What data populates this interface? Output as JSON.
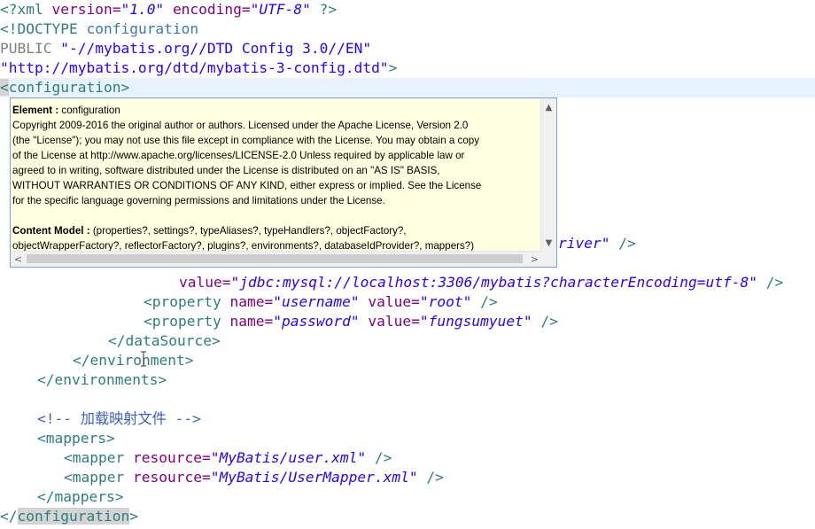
{
  "code": {
    "xml_decl_open": "<?xml",
    "version_attr": "version=",
    "version_val": "\"1.0\"",
    "encoding_attr": "encoding=",
    "encoding_val": "\"UTF-8\"",
    "xml_decl_close": "?>",
    "doctype_open": "<!DOCTYPE",
    "doctype_root": "configuration",
    "public_kw": "PUBLIC",
    "public_id": "\"-//mybatis.org//DTD Config 3.0//EN\"",
    "system_id": "\"http://mybatis.org/dtd/mybatis-3-config.dtd\"",
    "doctype_close": ">",
    "config_lt": "<",
    "config_name": "configuration",
    "config_gt": ">",
    "driver_tail": "river\"",
    "driver_close": " />",
    "url_attr": "value=",
    "url_val": "\"jdbc:mysql://localhost:3306/mybatis?characterEncoding=utf-8\"",
    "url_close": " />",
    "prop_tag": "<property",
    "name_attr": "name=",
    "value_attr": "value=",
    "username_name": "\"username\"",
    "username_value": "\"root\"",
    "password_name": "\"password\"",
    "password_value": "\"fungsumyuet\"",
    "self_close": " />",
    "datasource_close": "</dataSource>",
    "environment_close": "</environment>",
    "environments_close": "</environments>",
    "comment": "<!-- 加载映射文件 -->",
    "mappers_open": "<mappers>",
    "mapper_tag": "<mapper",
    "resource_attr": "resource=",
    "mapper1_val": "\"MyBatis/user.xml\"",
    "mapper2_val": "\"MyBatis/UserMapper.xml\"",
    "mappers_close": "</mappers>",
    "config_close_lt": "</",
    "config_close_name": "configuration",
    "config_close_gt": ">"
  },
  "popup": {
    "element_label": "Element :",
    "element_value": " configuration",
    "license_lines": [
      "Copyright 2009-2016 the original author or authors. Licensed under the Apache License, Version 2.0",
      " (the \"License\"); you may not use this file except in compliance with the License. You may obtain a copy",
      " of the License at http://www.apache.org/licenses/LICENSE-2.0 Unless required by applicable law or",
      " agreed to in writing, software distributed under the License is distributed on an \"AS IS\" BASIS,",
      " WITHOUT WARRANTIES OR CONDITIONS OF ANY KIND, either express or implied. See the License",
      " for the specific language governing permissions and limitations under the License."
    ],
    "content_model_label": "Content Model :",
    "content_model_line1": " (properties?, settings?, typeAliases?, typeHandlers?, objectFactory?,",
    "content_model_line2": " objectWrapperFactory?, reflectorFactory?, plugins?, environments?, databaseIdProvider?, mappers?)",
    "scroll_up": "▲",
    "scroll_down": "▼",
    "scroll_left": "<",
    "scroll_right": ">"
  }
}
